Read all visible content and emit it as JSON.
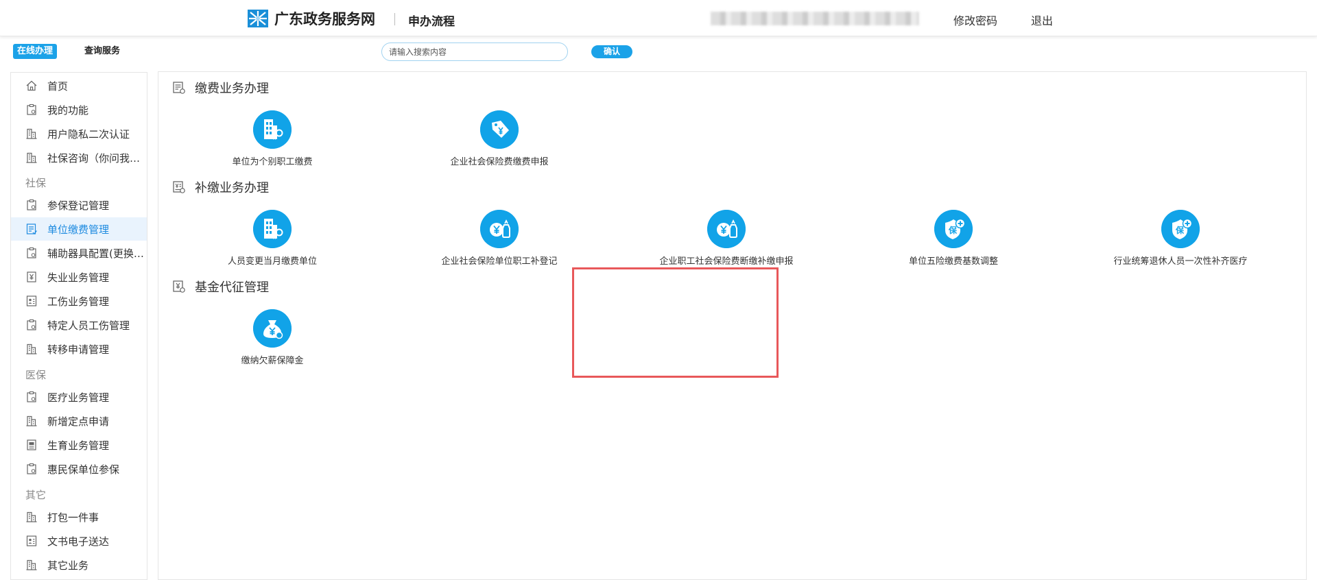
{
  "header": {
    "site_title": "广东政务服务网",
    "sub_title": "申办流程",
    "user_label": "",
    "change_password": "修改密码",
    "logout": "退出"
  },
  "top": {
    "tab_online": "在线办理",
    "tab_query": "查询服务",
    "search_placeholder": "请输入搜索内容",
    "confirm": "确认"
  },
  "sidebar": {
    "items": [
      {
        "label": "首页",
        "icon": "home-icon"
      },
      {
        "label": "我的功能",
        "icon": "clipboard-icon"
      },
      {
        "label": "用户隐私二次认证",
        "icon": "building-icon"
      },
      {
        "label": "社保咨询（你问我答）",
        "icon": "building-icon"
      }
    ],
    "groups": [
      {
        "title": "社保",
        "items": [
          {
            "label": "参保登记管理",
            "icon": "clipboard-icon"
          },
          {
            "label": "单位缴费管理",
            "icon": "form-icon",
            "active": true
          },
          {
            "label": "辅助器具配置(更换)管理",
            "icon": "clipboard-icon"
          },
          {
            "label": "失业业务管理",
            "icon": "yuan-doc-icon"
          },
          {
            "label": "工伤业务管理",
            "icon": "person-doc-icon"
          },
          {
            "label": "特定人员工伤管理",
            "icon": "clipboard-icon"
          },
          {
            "label": "转移申请管理",
            "icon": "building-icon"
          }
        ]
      },
      {
        "title": "医保",
        "items": [
          {
            "label": "医疗业务管理",
            "icon": "clipboard-icon"
          },
          {
            "label": "新增定点申请",
            "icon": "building-icon"
          },
          {
            "label": "生育业务管理",
            "icon": "list-doc-icon"
          },
          {
            "label": "惠民保单位参保",
            "icon": "clipboard-icon"
          }
        ]
      },
      {
        "title": "其它",
        "items": [
          {
            "label": "打包一件事",
            "icon": "building-icon"
          },
          {
            "label": "文书电子送达",
            "icon": "person-doc-icon"
          },
          {
            "label": "其它业务",
            "icon": "building-icon"
          }
        ]
      }
    ]
  },
  "sections": [
    {
      "title": "缴费业务办理",
      "icon": "form-section-icon",
      "services": [
        {
          "label": "单位为个别职工缴费",
          "icon": "building-key-icon"
        },
        {
          "label": "企业社会保险费缴费申报",
          "icon": "price-tag-yuan-icon"
        }
      ]
    },
    {
      "title": "补缴业务办理",
      "icon": "yuan-list-section-icon",
      "services": [
        {
          "label": "人员变更当月缴费单位",
          "icon": "building-key-icon"
        },
        {
          "label": "企业社会保险单位职工补登记",
          "icon": "yuan-bag-icon",
          "highlighted": true
        },
        {
          "label": "企业职工社会保险费断缴补缴申报",
          "icon": "yuan-bag-icon"
        },
        {
          "label": "单位五险缴费基数调整",
          "icon": "shield-plus-icon"
        },
        {
          "label": "行业统筹退休人员一次性补齐医疗",
          "icon": "shield-plus-icon"
        }
      ]
    },
    {
      "title": "基金代征管理",
      "icon": "yuan-form-section-icon",
      "services": [
        {
          "label": "缴纳欠薪保障金",
          "icon": "money-bag-icon"
        }
      ]
    }
  ],
  "colors": {
    "primary": "#1ba2e8",
    "service_circle": "#11a3e8",
    "active_bg": "#e9f3fd",
    "highlight_border": "#e8585a"
  }
}
